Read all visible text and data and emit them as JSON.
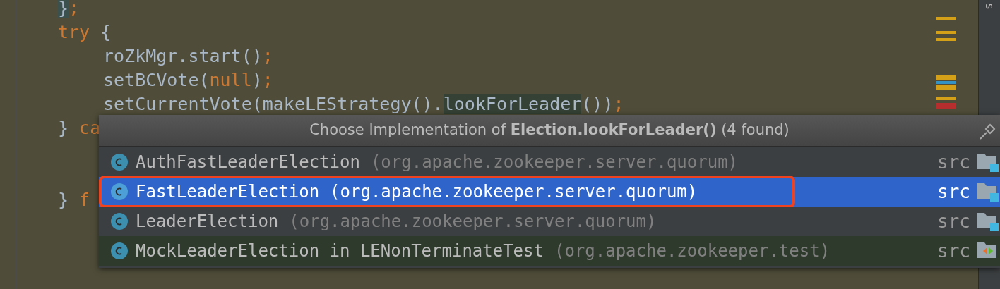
{
  "editor": {
    "lines": [
      {
        "kind": "outer",
        "tokens": [
          {
            "text": "}",
            "kind": "brace-hl"
          },
          {
            "text": ";",
            "kind": "punct"
          }
        ]
      },
      {
        "kind": "outer",
        "tokens": [
          {
            "text": "try",
            "kind": "keyword"
          },
          {
            "text": " {",
            "kind": "plain"
          }
        ]
      },
      {
        "kind": "inner",
        "tokens": [
          {
            "text": "roZkMgr.start()",
            "kind": "plain"
          },
          {
            "text": ";",
            "kind": "punct"
          }
        ]
      },
      {
        "kind": "inner",
        "tokens": [
          {
            "text": "setBCVote(",
            "kind": "plain"
          },
          {
            "text": "null",
            "kind": "keyword"
          },
          {
            "text": ")",
            "kind": "plain"
          },
          {
            "text": ";",
            "kind": "punct"
          }
        ]
      },
      {
        "kind": "inner",
        "tokens": [
          {
            "text": "setCurrentVote(makeLEStrategy().",
            "kind": "plain"
          },
          {
            "text": "lookForLeader",
            "kind": "usage"
          },
          {
            "text": "())",
            "kind": "plain"
          },
          {
            "text": ";",
            "kind": "punct"
          }
        ]
      },
      {
        "kind": "outer",
        "tokens": [
          {
            "text": "} ",
            "kind": "plain"
          },
          {
            "text": "ca",
            "kind": "keyword"
          }
        ]
      },
      {
        "kind": "blank"
      },
      {
        "kind": "blank"
      },
      {
        "kind": "outer",
        "tokens": [
          {
            "text": "} ",
            "kind": "plain"
          },
          {
            "text": "f",
            "kind": "keyword"
          }
        ]
      }
    ],
    "stripe_marks": [
      {
        "color": "#d4a017"
      },
      {
        "color": "#d4a017"
      },
      {
        "color": "#d4a017"
      },
      {
        "color": "#d4a017"
      },
      {
        "color": "#3592c4"
      },
      {
        "color": "#d4a017"
      },
      {
        "color": "#d4a017"
      },
      {
        "color": "#b72e2e"
      }
    ],
    "side_tab": "s"
  },
  "popup": {
    "title": "Choose Implementation of **Election.lookForLeader()** (4 found)",
    "items": [
      {
        "name": "AuthFastLeaderElection",
        "package": "(org.apache.zookeeper.server.quorum)",
        "source": "src",
        "kind": "main",
        "selected": false
      },
      {
        "name": "FastLeaderElection",
        "package": "(org.apache.zookeeper.server.quorum)",
        "source": "src",
        "kind": "main",
        "selected": true
      },
      {
        "name": "LeaderElection",
        "package": "(org.apache.zookeeper.server.quorum)",
        "source": "src",
        "kind": "main",
        "selected": false
      },
      {
        "name": "MockLeaderElection in LENonTerminateTest",
        "package": "(org.apache.zookeeper.test)",
        "source": "src",
        "kind": "test",
        "selected": false
      }
    ]
  }
}
